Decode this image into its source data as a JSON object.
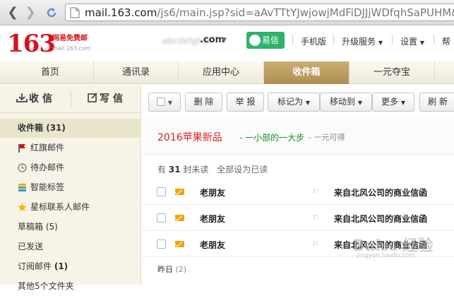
{
  "browser": {
    "url_host": "mail.163.com",
    "url_path": "/js6/main.jsp?sid=aAvTTtYJwjowjMdFiDJJjWDfqhSaPUHM&"
  },
  "header": {
    "logo_number": "163",
    "logo_text": "网易免费邮",
    "logo_domain": "mail.163.com",
    "account_suffix": ".com",
    "yixin_label": "易信",
    "links": [
      "手机版",
      "升级服务",
      "设置",
      "帮"
    ]
  },
  "tabs": [
    "首页",
    "通讯录",
    "应用中心",
    "收件箱",
    "一元夺宝"
  ],
  "sidebar": {
    "receive_label": "收信",
    "write_label": "写信",
    "folders": [
      {
        "label": "收件箱",
        "count": "(31)"
      },
      {
        "label": "红旗邮件",
        "icon": "red-flag-icon"
      },
      {
        "label": "待办邮件",
        "icon": "clock-icon"
      },
      {
        "label": "智能标签",
        "icon": "tag-icon"
      },
      {
        "label": "星标联系人邮件",
        "icon": "star-icon"
      },
      {
        "label": "草稿箱",
        "count": "(5)"
      },
      {
        "label": "已发送"
      },
      {
        "label": "订阅邮件",
        "count": "(1)"
      },
      {
        "label": "其他5个文件夹"
      }
    ]
  },
  "toolbar": {
    "delete": "删 除",
    "report": "举 报",
    "mark_as": "标记为",
    "move_to": "移动到",
    "more": "更多",
    "refresh": "刷 新"
  },
  "promo": {
    "title": "2016苹果新品",
    "subtitle": "- 一小部的一大步",
    "subtitle2": "- 一元可得"
  },
  "unread": {
    "prefix": "有",
    "count": "31",
    "suffix": "封未读",
    "mark_all": "全部设为已读"
  },
  "mails": [
    {
      "sender": "老朋友",
      "subject": "来自北风公司的商业信函"
    },
    {
      "sender": "老朋友",
      "subject": "来自北风公司的商业信函"
    },
    {
      "sender": "老朋友",
      "subject": "来自北风公司的商业信函"
    }
  ],
  "group": {
    "label": "昨日",
    "count": "(2)"
  },
  "watermark": {
    "text": "Baidu经验",
    "sub": "jingyan.baidu.com"
  },
  "colors": {
    "brand_red": "#d6121b",
    "tab_active": "#b08e50",
    "yixin_green": "#2db36e",
    "promo_red": "#d91d1d"
  }
}
